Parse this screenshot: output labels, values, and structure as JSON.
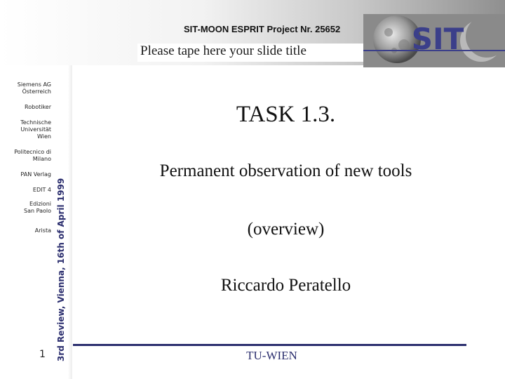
{
  "header": {
    "project_title": "SIT-MOON ESPRIT Project Nr. 25652",
    "slide_title_placeholder": "Please tape here your slide title",
    "logo_text": "SIT"
  },
  "partners": [
    {
      "lines": [
        "Siemens AG",
        "Österreich"
      ]
    },
    {
      "lines": [
        "Robotiker"
      ]
    },
    {
      "lines": [
        "Technische",
        "Universität",
        "Wien"
      ]
    },
    {
      "lines": [
        "Politecnico di",
        "Milano"
      ]
    },
    {
      "lines": [
        "PAN Verlag"
      ]
    },
    {
      "lines": [
        "EDIT 4"
      ]
    },
    {
      "lines": [
        "Edizioni",
        "San Paolo"
      ]
    },
    {
      "lines": [
        "Arista"
      ]
    }
  ],
  "sidebar": {
    "review_text": "3rd Review, Vienna, 16th of April 1999",
    "page_number": "1"
  },
  "content": {
    "task_title": "TASK 1.3.",
    "subtitle": "Permanent observation of new tools",
    "overview": "(overview)",
    "author": "Riccardo Peratello"
  },
  "footer": {
    "organization": "TU-WIEN"
  },
  "colors": {
    "accent": "#2b2e6e"
  }
}
